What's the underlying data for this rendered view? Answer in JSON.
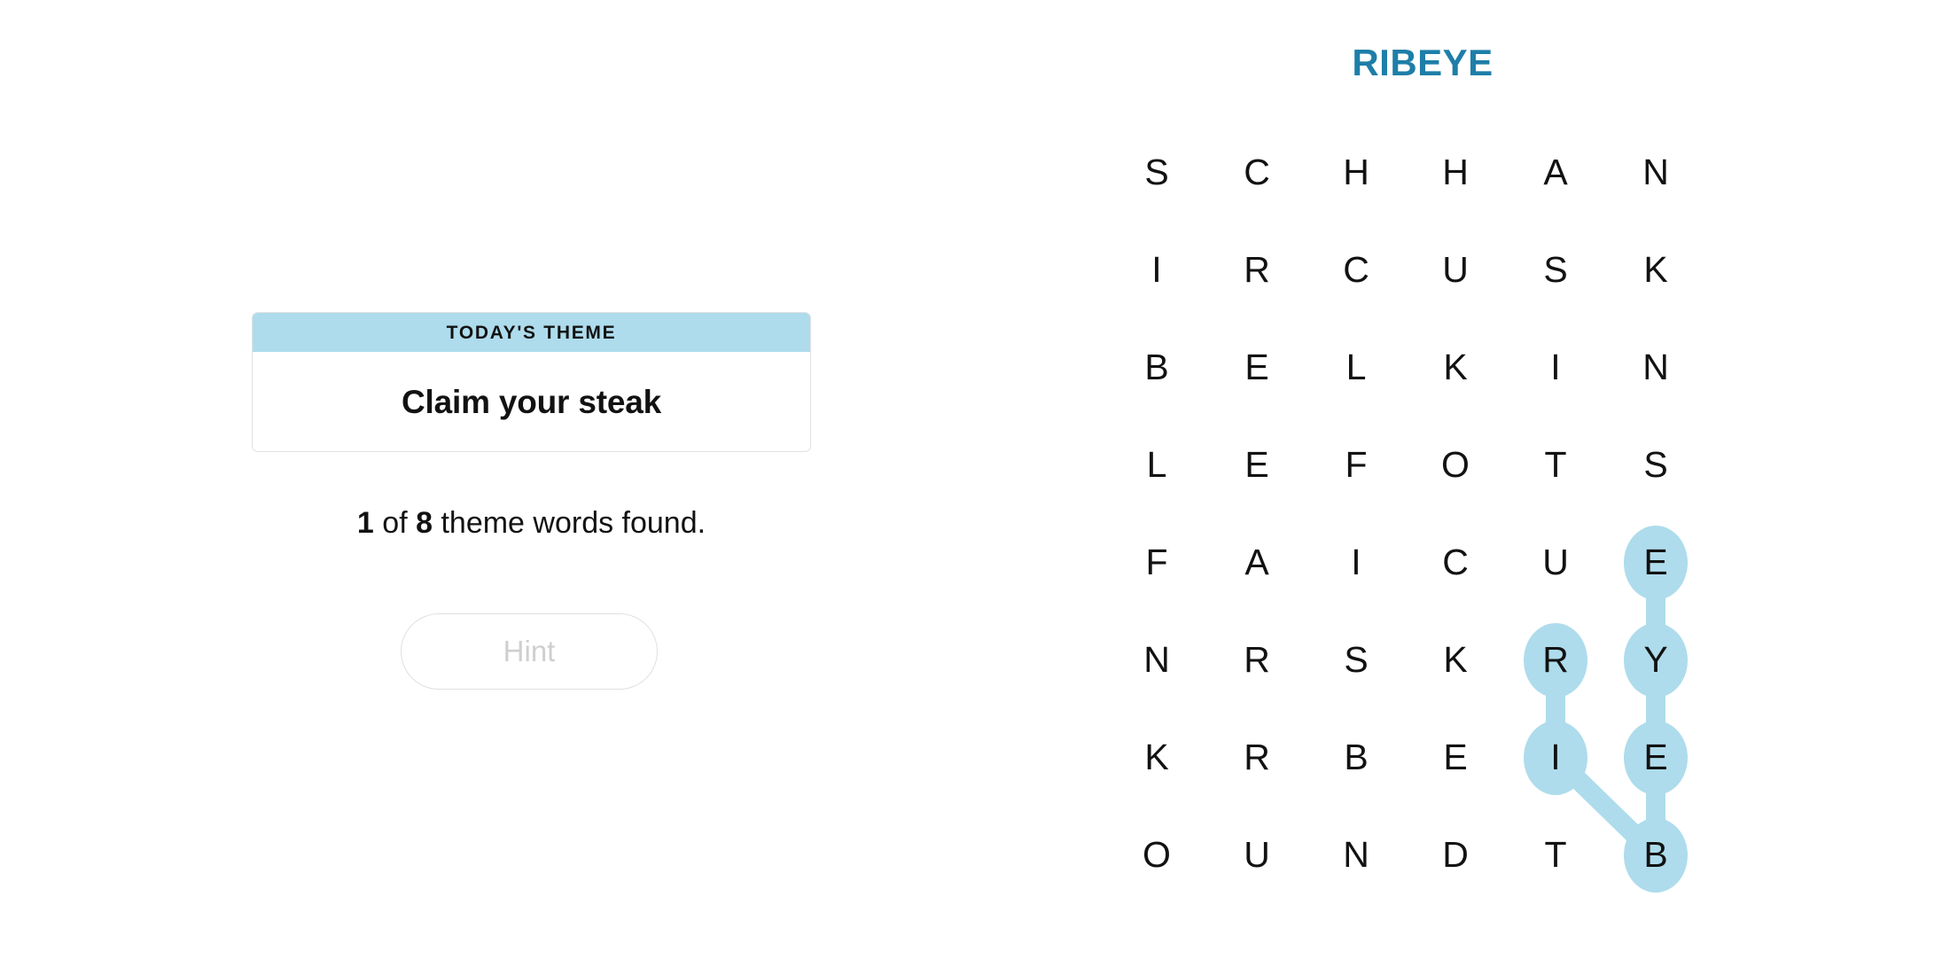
{
  "colors": {
    "title_teal": "#1E7EA8",
    "highlight_blue": "#AEDCEC",
    "theme_header_blue": "#AEDCEC",
    "text_dark": "#121212",
    "hint_disabled_text": "#CFCFCF",
    "card_border": "#E2E2E2",
    "page_background": "#FFFFFF"
  },
  "board": {
    "title": "RIBEYE",
    "rows": 8,
    "cols": 6,
    "letters": [
      [
        "S",
        "C",
        "H",
        "H",
        "A",
        "N"
      ],
      [
        "I",
        "R",
        "C",
        "U",
        "S",
        "K"
      ],
      [
        "B",
        "E",
        "L",
        "K",
        "I",
        "N"
      ],
      [
        "L",
        "E",
        "F",
        "O",
        "T",
        "S"
      ],
      [
        "F",
        "A",
        "I",
        "C",
        "U",
        "E"
      ],
      [
        "N",
        "R",
        "S",
        "K",
        "R",
        "Y"
      ],
      [
        "K",
        "R",
        "B",
        "E",
        "I",
        "E"
      ],
      [
        "O",
        "U",
        "N",
        "D",
        "T",
        "B"
      ]
    ],
    "highlighted_path": {
      "word": "RIBEYE",
      "cells": [
        {
          "row": 5,
          "col": 6,
          "letter": "E"
        },
        {
          "row": 6,
          "col": 6,
          "letter": "Y"
        },
        {
          "row": 7,
          "col": 6,
          "letter": "E"
        },
        {
          "row": 8,
          "col": 6,
          "letter": "B"
        },
        {
          "row": 7,
          "col": 5,
          "letter": "I"
        },
        {
          "row": 6,
          "col": 5,
          "letter": "R"
        }
      ]
    }
  },
  "theme_panel": {
    "header_label": "TODAY'S THEME",
    "clue": "Claim your steak"
  },
  "progress": {
    "found_count": "1",
    "total_count": "8",
    "prefix": "",
    "middle": " of ",
    "suffix": " theme words found."
  },
  "hint_button": {
    "label": "Hint",
    "enabled": false
  }
}
